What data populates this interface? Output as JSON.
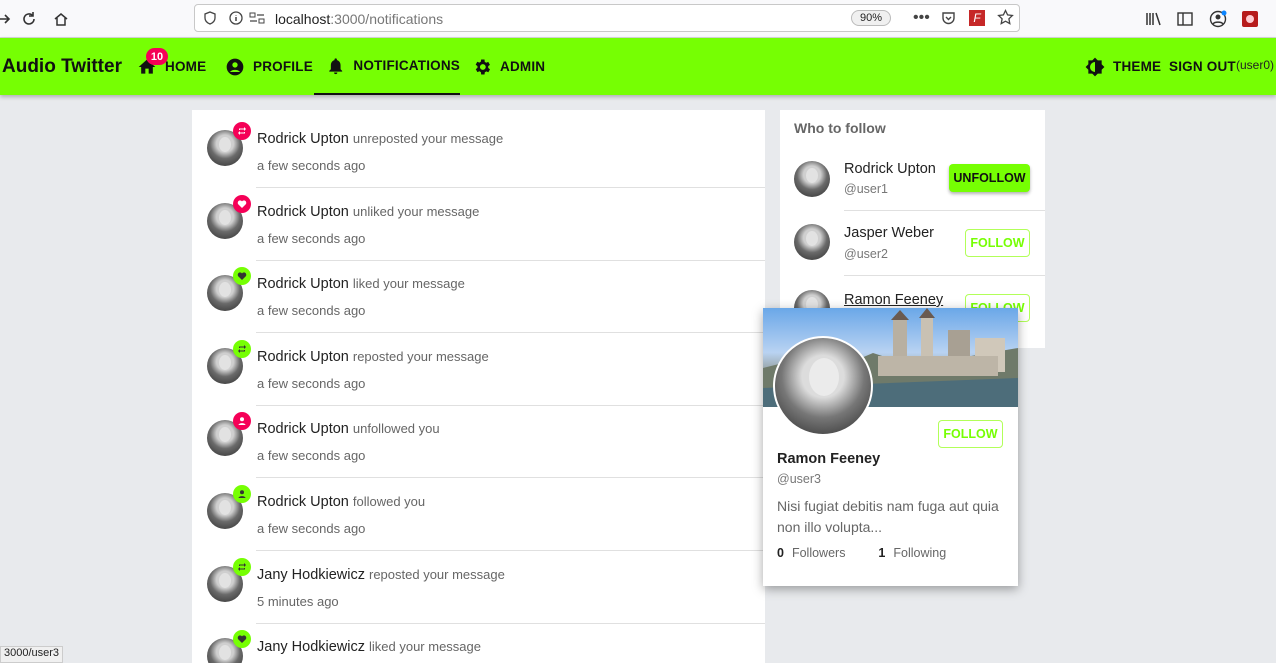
{
  "browser": {
    "url_host": "localhost",
    "url_path": ":3000/notifications",
    "zoom": "90%",
    "status_url": "3000/user3"
  },
  "app": {
    "title": "Audio Twitter",
    "accent_color": "#76ff03",
    "badge_color": "#f50057",
    "nav": {
      "home": "HOME",
      "home_badge": "10",
      "profile": "PROFILE",
      "notifications": "NOTIFICATIONS",
      "admin": "ADMIN",
      "theme": "THEME",
      "sign_out": "SIGN OUT",
      "user": "(user0)"
    }
  },
  "notifications": [
    {
      "name": "Rodrick Upton",
      "action": "unreposted your message",
      "time": "a few seconds ago",
      "icon": "repost-icon",
      "badge": "red"
    },
    {
      "name": "Rodrick Upton",
      "action": "unliked your message",
      "time": "a few seconds ago",
      "icon": "heart-icon",
      "badge": "red"
    },
    {
      "name": "Rodrick Upton",
      "action": "liked your message",
      "time": "a few seconds ago",
      "icon": "heart-icon",
      "badge": "green"
    },
    {
      "name": "Rodrick Upton",
      "action": "reposted your message",
      "time": "a few seconds ago",
      "icon": "repost-icon",
      "badge": "green"
    },
    {
      "name": "Rodrick Upton",
      "action": "unfollowed you",
      "time": "a few seconds ago",
      "icon": "person-icon",
      "badge": "red"
    },
    {
      "name": "Rodrick Upton",
      "action": "followed you",
      "time": "a few seconds ago",
      "icon": "person-icon",
      "badge": "green"
    },
    {
      "name": "Jany Hodkiewicz",
      "action": "reposted your message",
      "time": "5 minutes ago",
      "icon": "repost-icon",
      "badge": "green"
    },
    {
      "name": "Jany Hodkiewicz",
      "action": "liked your message",
      "time": "",
      "icon": "heart-icon",
      "badge": "green"
    }
  ],
  "who_to_follow": {
    "title": "Who to follow",
    "users": [
      {
        "name": "Rodrick Upton",
        "handle": "@user1",
        "button": "UNFOLLOW"
      },
      {
        "name": "Jasper Weber",
        "handle": "@user2",
        "button": "FOLLOW"
      },
      {
        "name": "Ramon Feeney",
        "handle": "",
        "button": "FOLLOW"
      }
    ]
  },
  "hover_card": {
    "name": "Ramon Feeney",
    "handle": "@user3",
    "bio": "Nisi fugiat debitis nam fuga aut quia non illo volupta...",
    "followers_count": "0",
    "followers_label": "Followers",
    "following_count": "1",
    "following_label": "Following",
    "follow_button": "FOLLOW"
  }
}
